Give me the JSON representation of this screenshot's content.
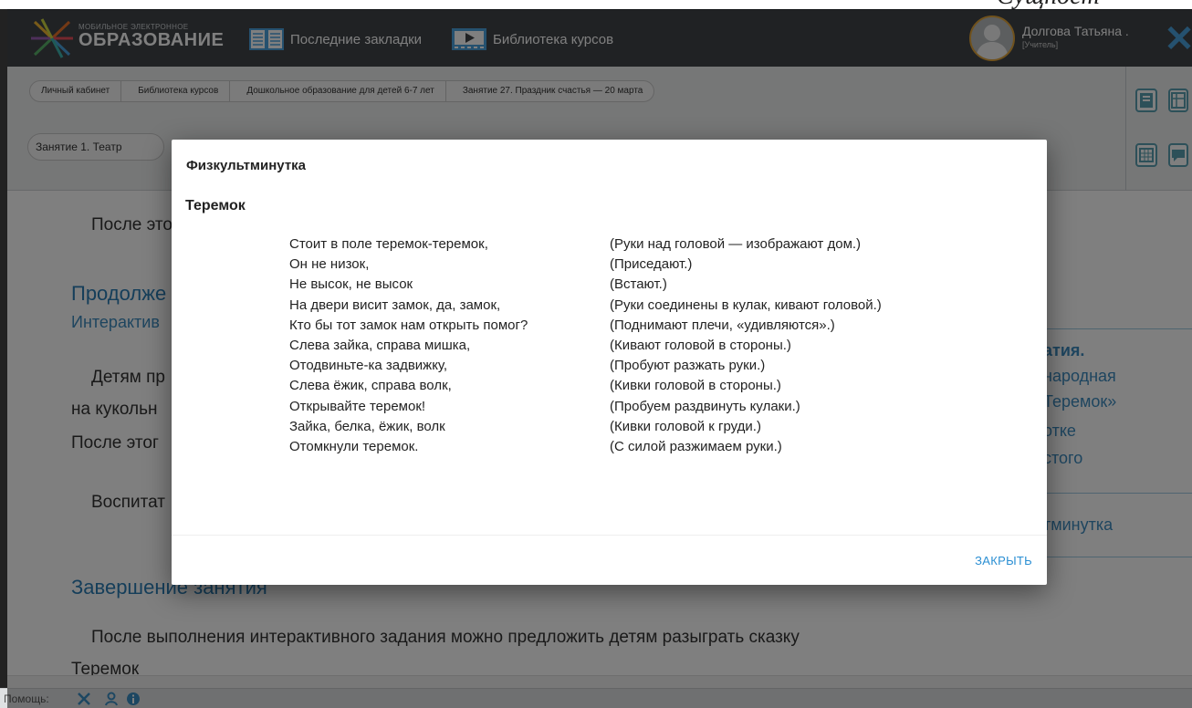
{
  "top_cut_text": "Сущност",
  "header": {
    "logo_small": "МОБИЛЬНОЕ ЭЛЕКТРОННОЕ",
    "logo_big": "ОБРАЗОВАНИЕ",
    "nav": [
      {
        "label": "Последние закладки",
        "icon": "open-book-icon"
      },
      {
        "label": "Библиотека курсов",
        "icon": "video-library-icon"
      }
    ],
    "user_name": "Долгова Татьяна .",
    "user_role": "[Учитель]",
    "close_icon": "close-icon"
  },
  "breadcrumb": [
    "Личный кабинет",
    "Библиотека курсов",
    "Дошкольное образование для детей 6-7 лет",
    "Занятие 27. Праздник счастья — 20 марта"
  ],
  "lesson_select": "Занятие 1. Театр",
  "content": {
    "p1": "После это",
    "heading1": "Продолже",
    "subhead1": "Интерактив",
    "p2": "Детям пр",
    "p3": "на кукольн",
    "p4": "После этог",
    "p5": "Воспитат",
    "heading2": "Завершение занятия",
    "p6": "После выполнения интерактивного задания можно предложить детям разыграть сказку",
    "p7": "Теремок"
  },
  "right_panel": {
    "line1": "атия.",
    "line2": "народная",
    "line3": "Теремок»",
    "line4": "отке",
    "line5": "стого",
    "line6": "тминутка"
  },
  "footer": {
    "help_label": "Помощь:"
  },
  "modal": {
    "title": "Физкультминутка",
    "subtitle": "Теремок",
    "rows": [
      {
        "left": "Стоит в поле теремок-теремок,",
        "right": "(Руки над головой — изображают дом.)"
      },
      {
        "left": "Он не низок,",
        "right": "(Приседают.)"
      },
      {
        "left": "Не высок, не высок",
        "right": "(Встают.)"
      },
      {
        "left": "На двери висит замок, да, замок,",
        "right": "(Руки соединены в кулак, кивают головой.)"
      },
      {
        "left": "Кто бы тот замок нам открыть помог?",
        "right": "(Поднимают плечи, «удивляются».)"
      },
      {
        "left": "Слева зайка, справа мишка,",
        "right": "(Кивают головой в стороны.)"
      },
      {
        "left": "Отодвиньте-ка задвижку,",
        "right": "(Пробуют разжать руки.)"
      },
      {
        "left": "Слева ёжик, справа волк,",
        "right": "(Кивки головой в стороны.)"
      },
      {
        "left": "Открывайте теремок!",
        "right": "(Пробуем раздвинуть кулаки.)"
      },
      {
        "left": "Зайка, белка, ёжик, волк",
        "right": "(Кивки головой к груди.)"
      },
      {
        "left": "Отомкнули теремок.",
        "right": "(С силой разжимаем руки.)"
      }
    ],
    "close_label": "ЗАКРЫТЬ"
  }
}
